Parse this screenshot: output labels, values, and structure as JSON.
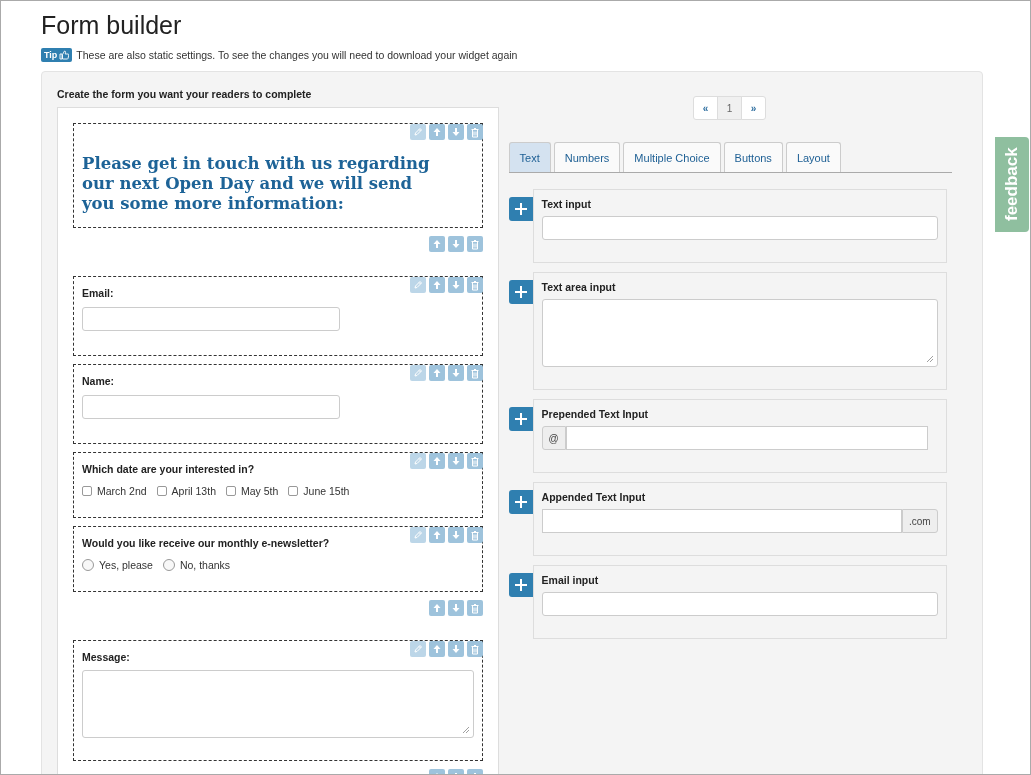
{
  "page_title": "Form builder",
  "tip": {
    "badge": "Tip",
    "text": "These are also static settings. To see the changes you will need to download your widget again"
  },
  "builder": {
    "heading": "Create the form you want your readers to complete",
    "blocks": [
      {
        "kind": "heading",
        "text": "Please get in touch with us regarding our next Open Day and we will send you some more information:"
      },
      {
        "kind": "toolbar"
      },
      {
        "kind": "text",
        "label": "Email:"
      },
      {
        "kind": "text",
        "label": "Name:"
      },
      {
        "kind": "checkboxes",
        "label": "Which date are your interested in?",
        "options": [
          {
            "label": "March 2nd",
            "checked": false
          },
          {
            "label": "April 13th",
            "checked": false
          },
          {
            "label": "May 5th",
            "checked": false
          },
          {
            "label": "June 15th",
            "checked": false
          }
        ]
      },
      {
        "kind": "radios",
        "label": "Would you like receive our monthly e-newsletter?",
        "options": [
          {
            "label": "Yes, please",
            "selected": false
          },
          {
            "label": "No, thanks",
            "selected": false
          }
        ]
      },
      {
        "kind": "toolbar"
      },
      {
        "kind": "textarea",
        "label": "Message:"
      },
      {
        "kind": "toolbar"
      }
    ]
  },
  "pager": {
    "prev": "«",
    "pages": [
      {
        "label": "1",
        "selected": true
      }
    ],
    "next": "»"
  },
  "tabs": [
    {
      "label": "Text",
      "selected": true
    },
    {
      "label": "Numbers",
      "selected": false
    },
    {
      "label": "Multiple Choice",
      "selected": false
    },
    {
      "label": "Buttons",
      "selected": false
    },
    {
      "label": "Layout",
      "selected": false
    }
  ],
  "widgets": [
    {
      "kind": "text",
      "label": "Text input"
    },
    {
      "kind": "textarea",
      "label": "Text area input"
    },
    {
      "kind": "prepend",
      "label": "Prepended Text Input",
      "addon": "@"
    },
    {
      "kind": "append",
      "label": "Appended Text Input",
      "addon": ".com"
    },
    {
      "kind": "text",
      "label": "Email input"
    }
  ],
  "feedback_tab": "feedback"
}
